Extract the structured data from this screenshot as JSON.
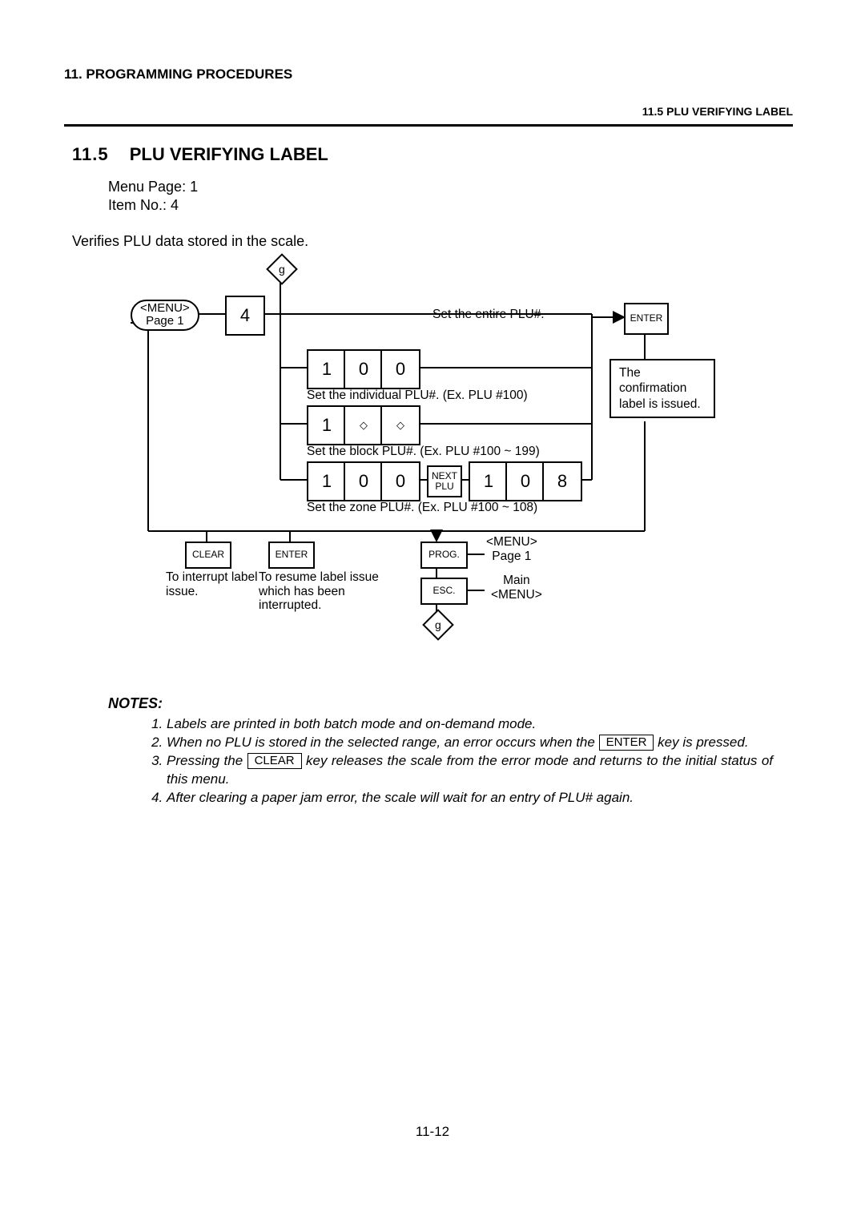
{
  "chapter": "11.   PROGRAMMING PROCEDURES",
  "header_corner": "11.5 PLU VERIFYING LABEL",
  "section_number": "11.5",
  "section_title": "PLU VERIFYING LABEL",
  "meta": {
    "menu_page_label": "Menu Page: 1",
    "item_no_label": "Item No.:       4"
  },
  "description": "Verifies PLU data stored in the scale.",
  "flow": {
    "g_top": "g",
    "menu_pill": "<MENU>\nPage 1",
    "key_4": "4",
    "row1_label": "Set the entire PLU#.",
    "row2_keys": [
      "1",
      "0",
      "0"
    ],
    "row2_label": "Set the individual PLU#.   (Ex. PLU #100)",
    "row3_keys": [
      "1",
      "◇",
      "◇"
    ],
    "row3_label": "Set the block PLU#.    (Ex. PLU #100 ~ 199)",
    "row4_keys_a": [
      "1",
      "0",
      "0"
    ],
    "nextplu": "NEXT\nPLU",
    "row4_keys_b": [
      "1",
      "0",
      "8"
    ],
    "row4_label": "Set the zone PLU#.    (Ex. PLU #100 ~ 108)",
    "enter": "ENTER",
    "confirmation": "The confirmation label is issued.",
    "clear": "CLEAR",
    "clear_note": "To interrupt label issue.",
    "enter2": "ENTER",
    "enter2_note": "To resume label issue which has been interrupted.",
    "prog": "PROG.",
    "prog_label": "<MENU>\nPage 1",
    "esc": "ESC.",
    "esc_label": "Main\n<MENU>",
    "g_bottom": "g"
  },
  "notes_heading": "NOTES:",
  "notes": {
    "n1": "Labels are printed in both batch mode and on-demand mode.",
    "n2_pre": "When no PLU is stored in the selected range, an error occurs when the",
    "n2_key": "ENTER",
    "n2_post": " key  is pressed.",
    "n3_pre": "Pressing the",
    "n3_key": "CLEAR",
    "n3_post": " key releases the scale from the error mode and returns to the initial status of this menu.",
    "n4": "After clearing a paper jam error, the scale will wait for an entry of PLU# again."
  },
  "page_num": "11-12"
}
